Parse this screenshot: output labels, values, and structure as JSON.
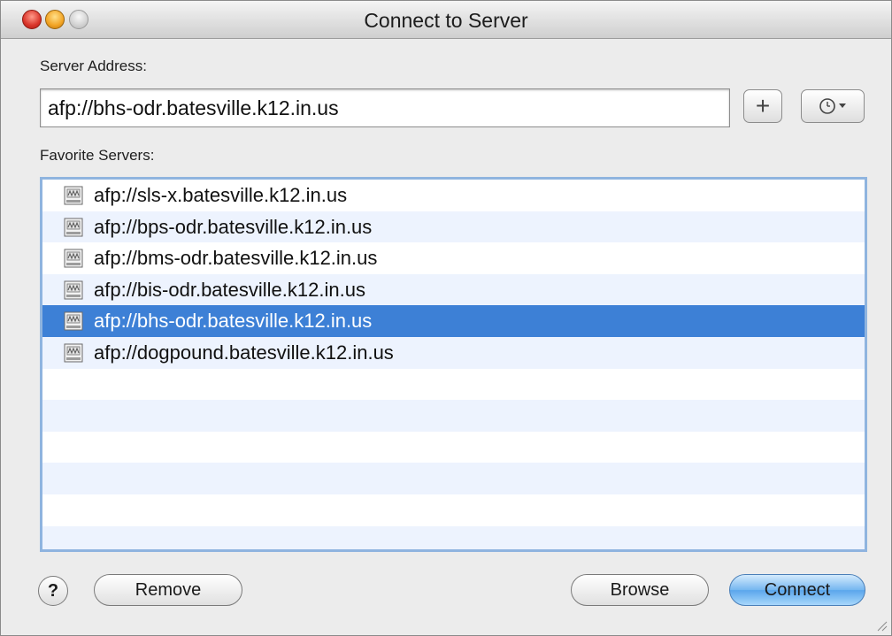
{
  "window": {
    "title": "Connect to Server"
  },
  "server_address": {
    "label": "Server Address:",
    "value": "afp://bhs-odr.batesville.k12.in.us"
  },
  "buttons": {
    "add": "+",
    "help": "?",
    "remove": "Remove",
    "browse": "Browse",
    "connect": "Connect"
  },
  "favorites": {
    "label": "Favorite Servers:",
    "items": [
      "afp://sls-x.batesville.k12.in.us",
      "afp://bps-odr.batesville.k12.in.us",
      "afp://bms-odr.batesville.k12.in.us",
      "afp://bis-odr.batesville.k12.in.us",
      "afp://bhs-odr.batesville.k12.in.us",
      "afp://dogpound.batesville.k12.in.us"
    ],
    "selected_index": 4
  },
  "icons": {
    "server": "server-icon",
    "action": "action-gear-icon"
  },
  "colors": {
    "selection": "#3d80d6",
    "alt_row": "#edf3fe",
    "focus_ring": "#8fb4df"
  }
}
